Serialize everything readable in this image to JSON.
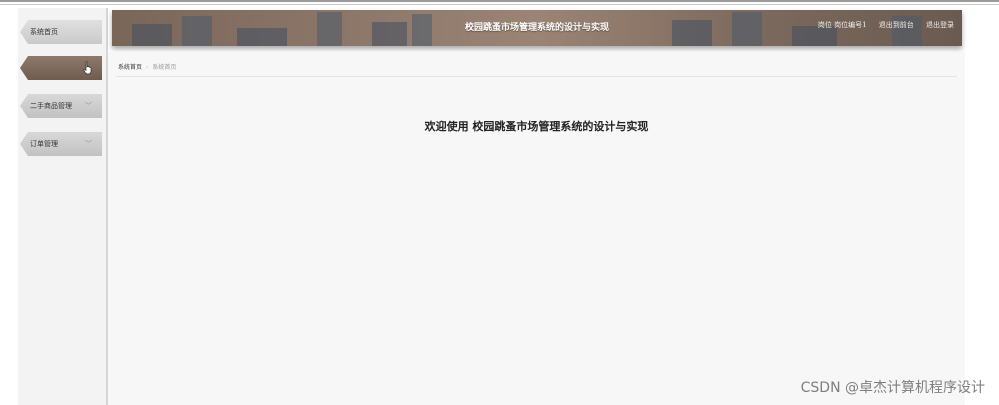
{
  "sidebar": {
    "items": [
      {
        "label": "系统首页"
      },
      {
        "label": ""
      },
      {
        "label": "二手商品管理",
        "chevron": "﹀"
      },
      {
        "label": "订单管理",
        "chevron": "﹀"
      }
    ]
  },
  "header": {
    "title": "校园跳蚤市场管理系统的设计与实现",
    "role_text": "岗位 岗位编号1",
    "front_link": "退出到前台",
    "logout_link": "退出登录"
  },
  "breadcrumb": {
    "home": "系统首页",
    "separator": "›",
    "current": "系统首页"
  },
  "main": {
    "welcome": "欢迎使用 校园跳蚤市场管理系统的设计与实现"
  },
  "watermark": "CSDN @卓杰计算机程序设计",
  "colors": {
    "banner": "#8a7568",
    "active_item": "#7a6658",
    "content_bg": "#f7f7f7"
  },
  "icons": {
    "cursor": "hand-pointer-icon"
  }
}
